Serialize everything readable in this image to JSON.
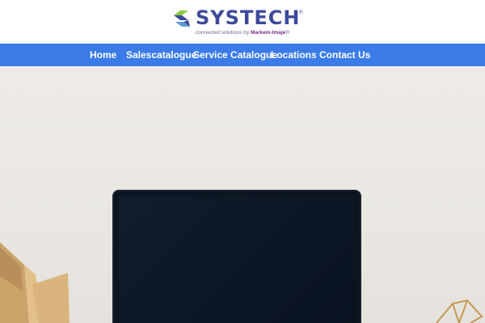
{
  "header": {
    "logo": {
      "wordmark": "SYSTECH",
      "registered": "®",
      "tagline_prefix": "connected solutions by ",
      "tagline_brand": "Markem-Imaje",
      "tagline_suffix": "®"
    }
  },
  "nav": {
    "items": [
      {
        "label": "Home"
      },
      {
        "label": "Salescatalogue"
      },
      {
        "label": "Service Catalogue"
      },
      {
        "label": "Locations"
      },
      {
        "label": "Contact Us"
      }
    ]
  },
  "colors": {
    "nav_background": "#3b7be8",
    "logo_blue": "#3d4a9a",
    "logo_green": "#8cc63f",
    "brand_purple": "#7a2c8c"
  },
  "icons": {
    "logo_mark": "systech-logo-icon"
  }
}
